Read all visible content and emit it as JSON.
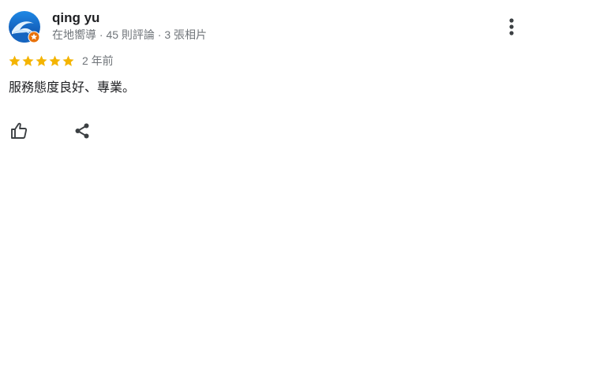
{
  "reviewer": {
    "name": "qing yu",
    "meta": "在地嚮導 · 45 則評論 · 3 張相片",
    "avatar_icon": "ocean-wave-avatar",
    "badge_icon": "local-guide-star-badge"
  },
  "review": {
    "rating": 5,
    "rating_max": 5,
    "date": "2 年前",
    "text": "服務態度良好、專業。"
  },
  "actions": {
    "more_icon": "more-vertical-icon",
    "like_icon": "thumbs-up-icon",
    "share_icon": "share-icon"
  },
  "colors": {
    "star": "#f4b400",
    "name_text": "#202124",
    "meta_text": "#70757a",
    "icon": "#5f6368",
    "badge": "#e8710a",
    "avatar_bg": "#1a73e8"
  }
}
